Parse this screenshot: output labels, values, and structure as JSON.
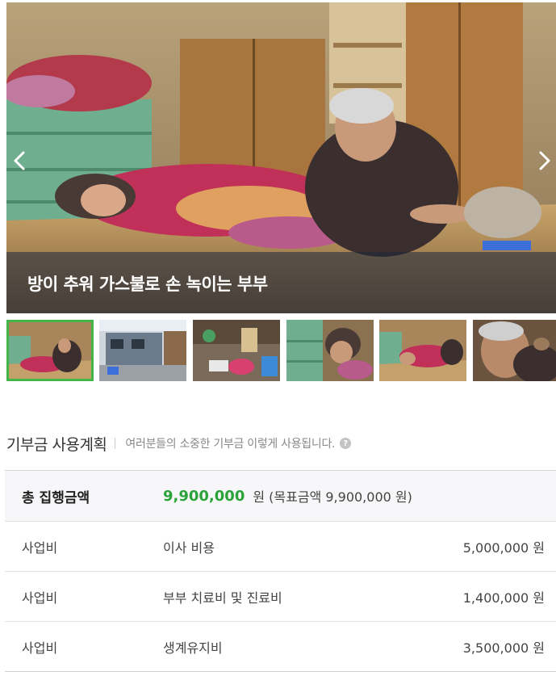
{
  "slider": {
    "caption": "방이 추워 가스불로 손 녹이는 부부",
    "prev_icon": "chevron-left-icon",
    "next_icon": "chevron-right-icon"
  },
  "thumbnails": [
    {
      "alt": "thumbnail-1",
      "active": true
    },
    {
      "alt": "thumbnail-2",
      "active": false
    },
    {
      "alt": "thumbnail-3",
      "active": false
    },
    {
      "alt": "thumbnail-4",
      "active": false
    },
    {
      "alt": "thumbnail-5",
      "active": false
    },
    {
      "alt": "thumbnail-6",
      "active": false
    }
  ],
  "plan": {
    "title": "기부금 사용계획",
    "subtitle": "여러분들의 소중한 기부금 이렇게 사용됩니다.",
    "help_icon": "question-icon",
    "total": {
      "label": "총 집행금액",
      "amount": "9,900,000",
      "unit_text": "원 (목표금액 9,900,000 원)"
    },
    "rows": [
      {
        "category": "사업비",
        "item": "이사 비용",
        "amount": "5,000,000 원"
      },
      {
        "category": "사업비",
        "item": "부부 치료비 및 진료비",
        "amount": "1,400,000 원"
      },
      {
        "category": "사업비",
        "item": "생계유지비",
        "amount": "3,500,000 원"
      }
    ]
  },
  "colors": {
    "accent_green": "#2ba33a",
    "active_thumb_border": "#44b648"
  }
}
